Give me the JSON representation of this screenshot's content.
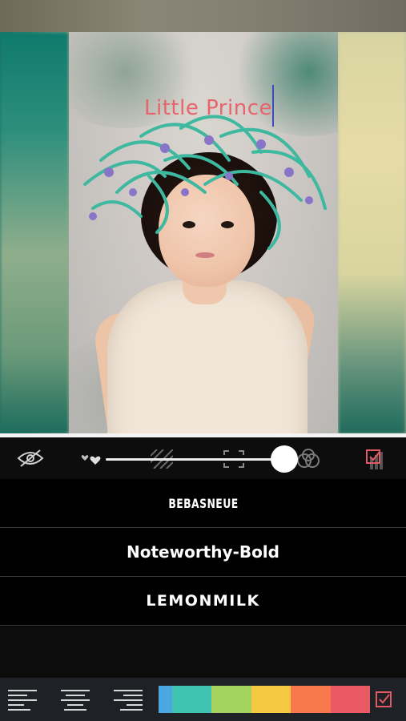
{
  "canvas": {
    "text_overlay": "Little Prince"
  },
  "controls": {
    "hide_icon": "eye-slash-icon",
    "slider_value": 0.99,
    "confirm_icon": "check-square-icon"
  },
  "fonts": [
    {
      "label": "BEBASNEUE"
    },
    {
      "label": "Noteworthy-Bold"
    },
    {
      "label": "LEMONMILK"
    }
  ],
  "toolbar": {
    "align_left": "align-left-icon",
    "align_center": "align-center-icon",
    "align_right": "align-right-icon",
    "colors": [
      "#4aa8e0",
      "#3ec4b0",
      "#a5d35f",
      "#f5c842",
      "#f7784a",
      "#ea5a64"
    ],
    "confirm_icon": "check-square-icon"
  }
}
